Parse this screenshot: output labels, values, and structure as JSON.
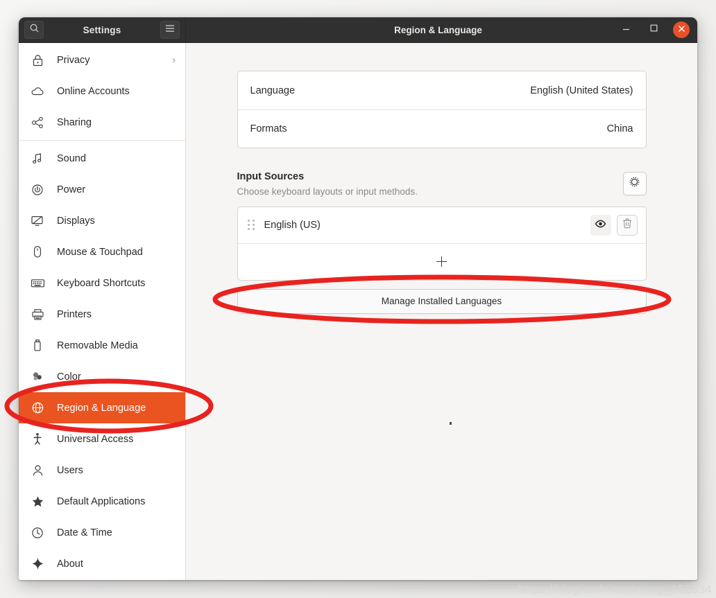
{
  "window": {
    "app_title": "Settings",
    "page_title": "Region & Language",
    "search_icon": "search-icon",
    "menu_icon": "hamburger-menu-icon",
    "minimize_label": "minimize",
    "maximize_label": "maximize",
    "close_label": "close",
    "accent_color": "#e95420",
    "titlebar_color": "#303030"
  },
  "sidebar": {
    "items": [
      {
        "label": "Privacy",
        "icon": "lock-icon",
        "chevron": "›",
        "selected": false,
        "separator_after": false
      },
      {
        "label": "Online Accounts",
        "icon": "cloud-icon",
        "selected": false,
        "separator_after": false
      },
      {
        "label": "Sharing",
        "icon": "share-icon",
        "selected": false,
        "separator_after": true
      },
      {
        "label": "Sound",
        "icon": "music-note-icon",
        "selected": false,
        "separator_after": false
      },
      {
        "label": "Power",
        "icon": "power-icon",
        "selected": false,
        "separator_after": false
      },
      {
        "label": "Displays",
        "icon": "display-icon",
        "selected": false,
        "separator_after": false
      },
      {
        "label": "Mouse & Touchpad",
        "icon": "mouse-icon",
        "selected": false,
        "separator_after": false
      },
      {
        "label": "Keyboard Shortcuts",
        "icon": "keyboard-icon",
        "selected": false,
        "separator_after": false
      },
      {
        "label": "Printers",
        "icon": "printer-icon",
        "selected": false,
        "separator_after": false
      },
      {
        "label": "Removable Media",
        "icon": "usb-drive-icon",
        "selected": false,
        "separator_after": false
      },
      {
        "label": "Color",
        "icon": "color-icon",
        "selected": false,
        "separator_after": false
      },
      {
        "label": "Region & Language",
        "icon": "globe-icon",
        "selected": true,
        "separator_after": false
      },
      {
        "label": "Universal Access",
        "icon": "accessibility-icon",
        "selected": false,
        "separator_after": false
      },
      {
        "label": "Users",
        "icon": "user-icon",
        "selected": false,
        "separator_after": false
      },
      {
        "label": "Default Applications",
        "icon": "star-icon",
        "selected": false,
        "separator_after": false
      },
      {
        "label": "Date & Time",
        "icon": "clock-icon",
        "selected": false,
        "separator_after": false
      },
      {
        "label": "About",
        "icon": "sparkle-icon",
        "selected": false,
        "separator_after": false
      }
    ]
  },
  "main": {
    "language_row": {
      "key": "Language",
      "value": "English (United States)"
    },
    "formats_row": {
      "key": "Formats",
      "value": "China"
    },
    "input_sources": {
      "title": "Input Sources",
      "subtitle": "Choose keyboard layouts or input methods.",
      "settings_icon": "gear-icon",
      "sources": [
        {
          "name": "English (US)",
          "drag_icon": "drag-handle-icon",
          "preview_icon": "eye-icon",
          "remove_icon": "trash-icon"
        }
      ],
      "add_icon": "plus-icon"
    },
    "manage_button": "Manage Installed Languages"
  },
  "annotations": {
    "highlight_color": "#e8231f",
    "ellipses": [
      {
        "target": "sidebar-item-region-language"
      },
      {
        "target": "manage-installed-languages-button"
      }
    ]
  },
  "watermark": "https://blog.csdn.net/meng_152634"
}
